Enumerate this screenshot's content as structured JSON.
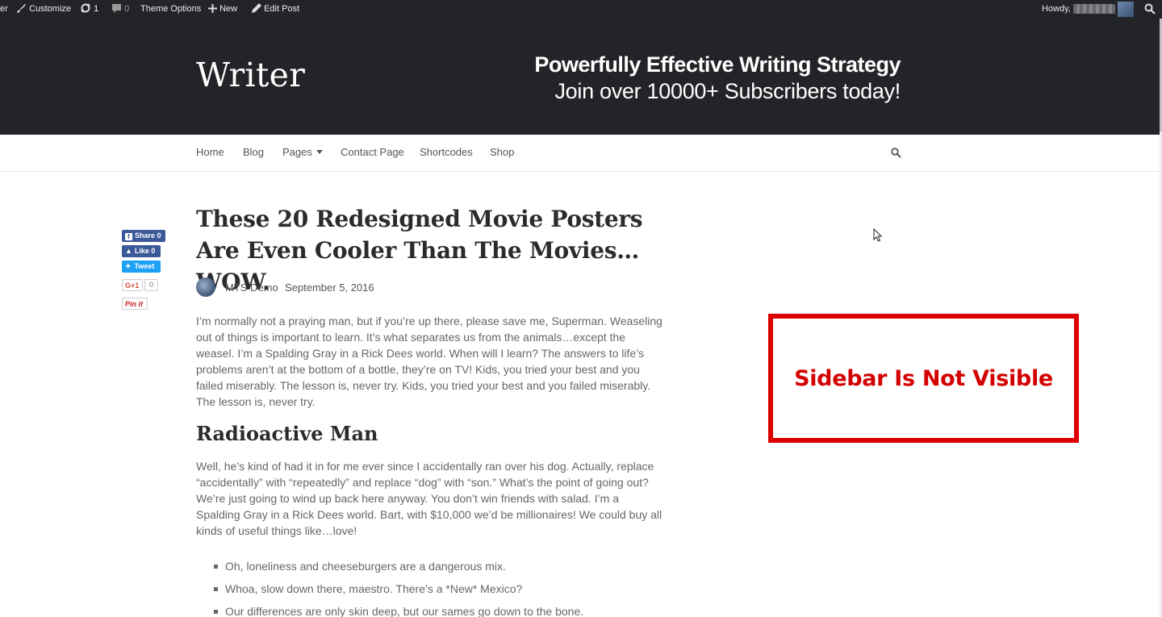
{
  "adminbar": {
    "first_fragment": "er",
    "customize": "Customize",
    "updates_count": "1",
    "comments_count": "0",
    "theme_options": "Theme Options",
    "new": "New",
    "edit_post": "Edit Post",
    "howdy": "Howdy,"
  },
  "header": {
    "logo": "Writer",
    "promo_line1": "Powerfully Effective Writing Strategy",
    "promo_line2": "Join over 10000+ Subscribers today!"
  },
  "nav": {
    "items": [
      "Home",
      "Blog",
      "Pages",
      "Contact Page",
      "Shortcodes",
      "Shop"
    ]
  },
  "social": {
    "fb_share": "Share 0",
    "fb_like": "Like 0",
    "tweet": "Tweet",
    "gplus": "G+1",
    "gplus_count": "0",
    "pin": "Pin it"
  },
  "post": {
    "title": "These 20 Redesigned Movie Posters Are Even Cooler Than The Movies… WOW.",
    "author": "MTS Demo",
    "date": "September 5, 2016",
    "para1": "I’m normally not a praying man, but if you’re up there, please save me, Superman. Weaseling out of things is important to learn. It’s what separates us from the animals…except the weasel. I’m a Spalding Gray in a Rick Dees world. When will I learn? The answers to life’s problems aren’t at the bottom of a bottle, they’re on TV! Kids, you tried your best and you failed miserably. The lesson is, never try. Kids, you tried your best and you failed miserably. The lesson is, never try.",
    "heading2": "Radioactive Man",
    "para2": "Well, he’s kind of had it in for me ever since I accidentally ran over his dog. Actually, replace “accidentally” with “repeatedly” and replace “dog” with “son.” What’s the point of going out? We’re just going to wind up back here anyway. You don’t win friends with salad. I’m a Spalding Gray in a Rick Dees world. Bart, with $10,000 we’d be millionaires! We could buy all kinds of useful things like…love!",
    "bullets": [
      "Oh, loneliness and cheeseburgers are a dangerous mix.",
      "Whoa, slow down there, maestro. There’s a *New* Mexico?",
      "Our differences are only skin deep, but our sames go down to the bone."
    ]
  },
  "annotation": {
    "text": "Sidebar Is Not Visible",
    "color": "#dc0000"
  },
  "colors": {
    "header_bg": "#232428",
    "adminbar_bg": "#232428"
  }
}
